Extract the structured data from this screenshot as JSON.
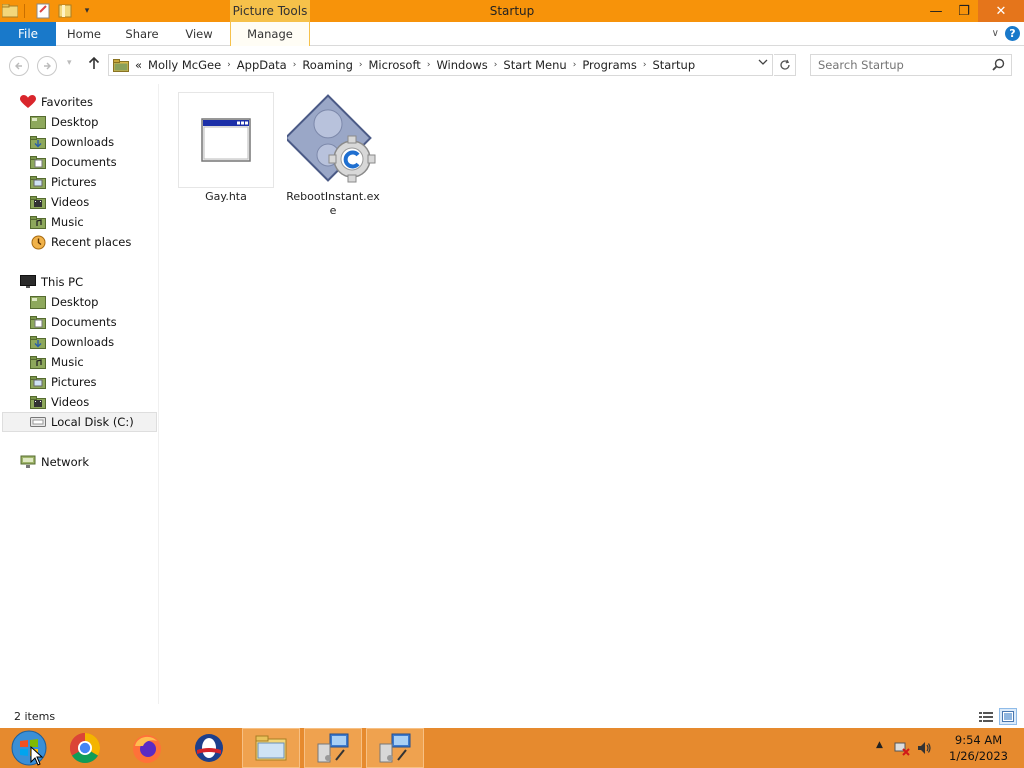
{
  "window": {
    "title": "Startup",
    "contextual_tab": "Picture Tools",
    "minimize": "—",
    "restore": "❐",
    "close": "✕"
  },
  "ribbon": {
    "tabs": [
      "File",
      "Home",
      "Share",
      "View",
      "Manage"
    ],
    "expand_glyph": "∨",
    "help_glyph": "?"
  },
  "address": {
    "overflow": "«",
    "crumbs": [
      "Molly McGee",
      "AppData",
      "Roaming",
      "Microsoft",
      "Windows",
      "Start Menu",
      "Programs",
      "Startup"
    ],
    "separator_glyph": "›"
  },
  "search": {
    "placeholder": "Search Startup"
  },
  "nav": {
    "favorites": {
      "label": "Favorites",
      "items": [
        {
          "label": "Desktop",
          "icon": "desktop-icon"
        },
        {
          "label": "Downloads",
          "icon": "downloads-icon"
        },
        {
          "label": "Documents",
          "icon": "documents-icon"
        },
        {
          "label": "Pictures",
          "icon": "pictures-icon"
        },
        {
          "label": "Videos",
          "icon": "videos-icon"
        },
        {
          "label": "Music",
          "icon": "music-icon"
        },
        {
          "label": "Recent places",
          "icon": "recent-places-icon"
        }
      ]
    },
    "this_pc": {
      "label": "This PC",
      "items": [
        {
          "label": "Desktop",
          "icon": "desktop-icon"
        },
        {
          "label": "Documents",
          "icon": "documents-icon"
        },
        {
          "label": "Downloads",
          "icon": "downloads-icon"
        },
        {
          "label": "Music",
          "icon": "music-icon"
        },
        {
          "label": "Pictures",
          "icon": "pictures-icon"
        },
        {
          "label": "Videos",
          "icon": "videos-icon"
        },
        {
          "label": "Local Disk (C:)",
          "icon": "local-disk-icon",
          "selected": true
        }
      ]
    },
    "network": {
      "label": "Network"
    }
  },
  "files": [
    {
      "name": "Gay.hta",
      "icon": "hta-window-icon"
    },
    {
      "name": "RebootInstant.exe",
      "icon": "exe-gear-icon"
    }
  ],
  "status": {
    "item_count": "2 items"
  },
  "taskbar": {
    "apps": [
      "start-orb-icon",
      "chrome-icon",
      "firefox-icon",
      "opera-icon",
      "file-explorer-icon",
      "remote-desktop-icon",
      "remote-desktop-icon"
    ],
    "time": "9:54 AM",
    "date": "1/26/2023"
  }
}
